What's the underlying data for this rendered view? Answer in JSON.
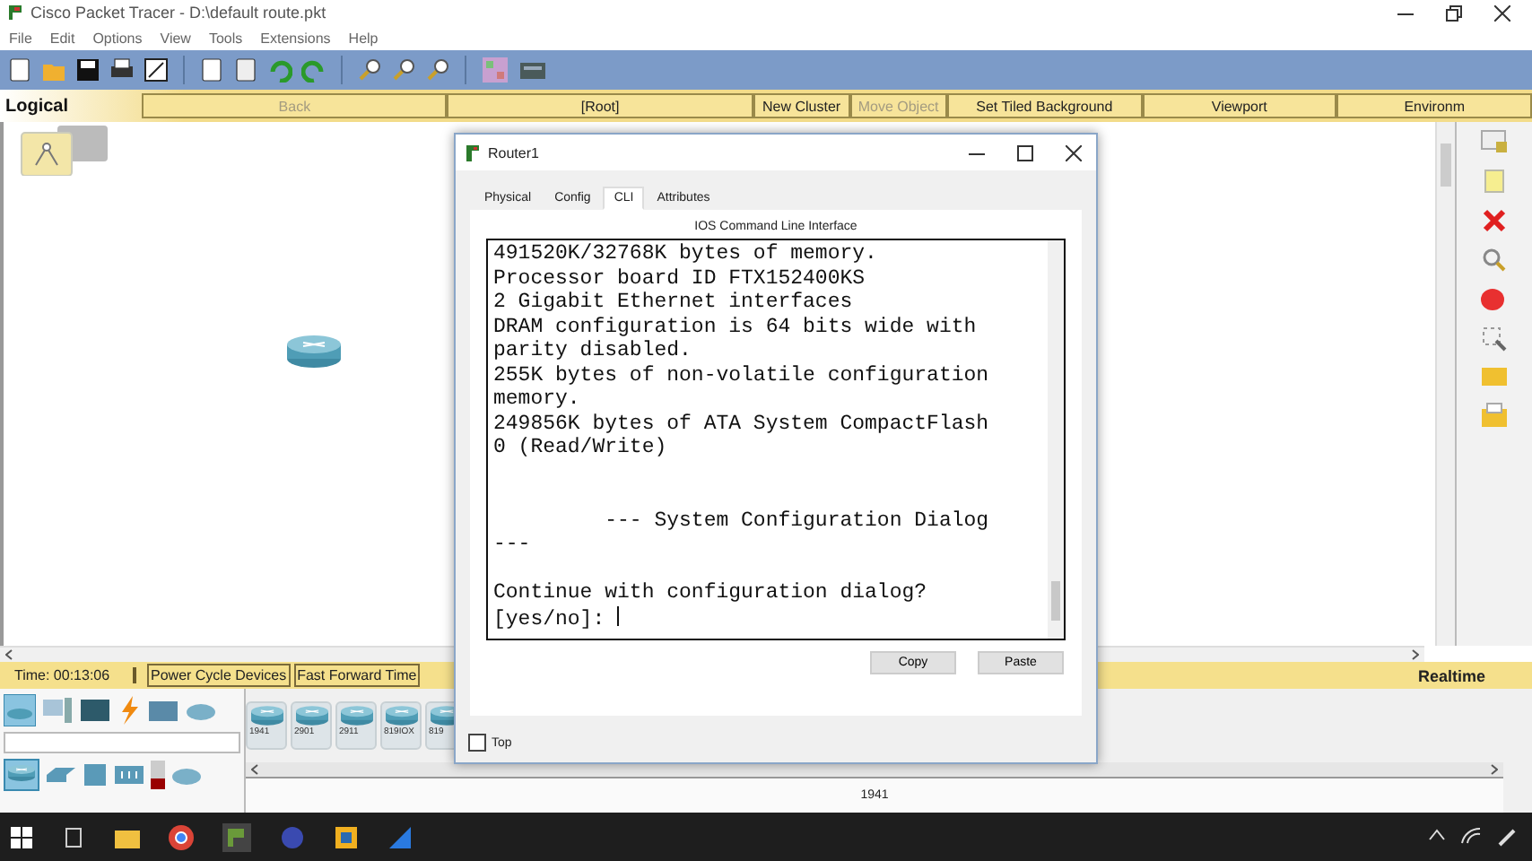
{
  "app": {
    "title": "Cisco Packet Tracer - D:\\default route.pkt"
  },
  "menu": [
    "File",
    "Edit",
    "Options",
    "View",
    "Tools",
    "Extensions",
    "Help"
  ],
  "nav_bar": {
    "mode": "Logical",
    "buttons": [
      {
        "label": "Back",
        "disabled": true
      },
      {
        "label": "[Root]",
        "disabled": false
      },
      {
        "label": "New Cluster",
        "disabled": false
      },
      {
        "label": "Move Object",
        "disabled": true
      },
      {
        "label": "Set Tiled Background",
        "disabled": false
      },
      {
        "label": "Viewport",
        "disabled": false
      },
      {
        "label": "Environm",
        "disabled": false
      }
    ]
  },
  "status_bar": {
    "time": "Time: 00:13:06",
    "buttons": [
      "Power Cycle Devices",
      "Fast Forward Time"
    ],
    "mode": "Realtime"
  },
  "device_models": [
    "1941",
    "2901",
    "2911",
    "819IOX",
    "819"
  ],
  "selected_model": "1941",
  "dialog": {
    "title": "Router1",
    "tabs": [
      {
        "label": "Physical",
        "selected": false
      },
      {
        "label": "Config",
        "selected": false
      },
      {
        "label": "CLI",
        "selected": true
      },
      {
        "label": "Attributes",
        "selected": false
      }
    ],
    "heading": "IOS Command Line Interface",
    "console_text": "491520K/32768K bytes of memory.\nProcessor board ID FTX152400KS\n2 Gigabit Ethernet interfaces\nDRAM configuration is 64 bits wide with\nparity disabled.\n255K bytes of non-volatile configuration\nmemory.\n249856K bytes of ATA System CompactFlash\n0 (Read/Write)\n\n\n         --- System Configuration Dialog\n---\n\nContinue with configuration dialog?\n[yes/no]: ",
    "buttons": [
      "Copy",
      "Paste"
    ],
    "top_checkbox": {
      "label": "Top",
      "checked": false
    }
  }
}
